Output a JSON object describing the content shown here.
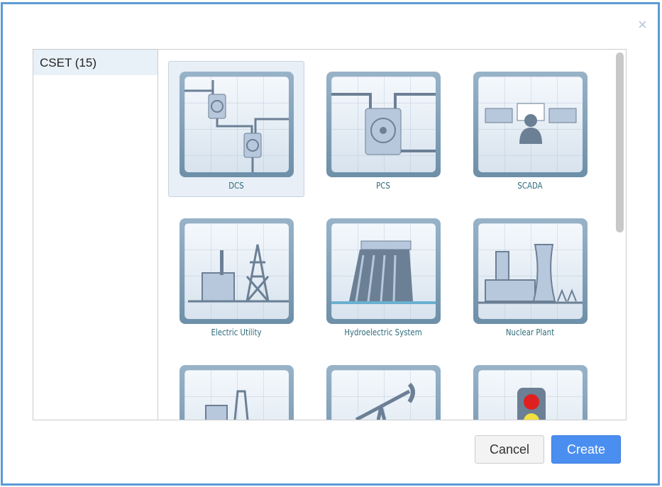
{
  "dialog": {
    "close_label": "×"
  },
  "sidebar": {
    "categories": [
      {
        "label": "CSET (15)"
      }
    ]
  },
  "gallery": {
    "items": [
      {
        "label": "DCS",
        "icon": "dcs-icon",
        "selected": true
      },
      {
        "label": "PCS",
        "icon": "pcs-icon"
      },
      {
        "label": "SCADA",
        "icon": "scada-icon"
      },
      {
        "label": "Electric Utility",
        "icon": "electric-utility-icon"
      },
      {
        "label": "Hydroelectric System",
        "icon": "hydroelectric-icon"
      },
      {
        "label": "Nuclear Plant",
        "icon": "nuclear-plant-icon"
      },
      {
        "icon": "oil-rig-icon"
      },
      {
        "icon": "pump-jack-icon"
      },
      {
        "icon": "traffic-light-icon"
      }
    ]
  },
  "footer": {
    "cancel_label": "Cancel",
    "create_label": "Create"
  },
  "colors": {
    "accent": "#4a8ef0",
    "border": "#5b9bd5",
    "icon": "#6b7f95"
  }
}
